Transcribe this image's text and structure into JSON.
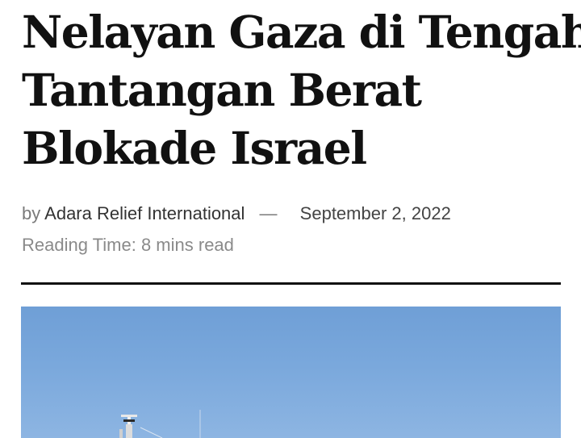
{
  "article": {
    "title_lines": [
      "Nelayan Gaza di Tengah",
      "Tantangan Berat",
      "Blokade Israel"
    ],
    "by_label": "by",
    "author": "Adara Relief International",
    "separator": "—",
    "date": "September 2, 2022",
    "reading_time": "Reading Time: 8 mins read"
  }
}
